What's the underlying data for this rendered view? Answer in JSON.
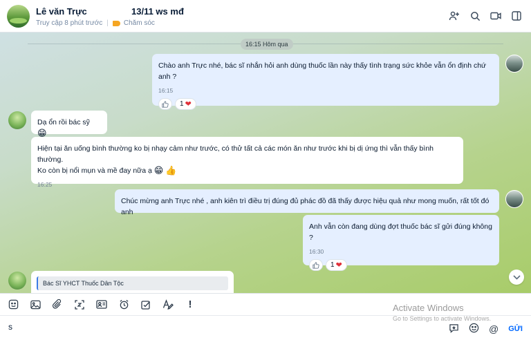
{
  "header": {
    "contact_name": "Lê văn Trực",
    "note": "13/11 ws mđ",
    "last_seen": "Truy cập 8 phút trước",
    "tag_label": "Chăm sóc",
    "tag_color": "#f5a623"
  },
  "header_icons": [
    "add-member-icon",
    "search-icon",
    "video-call-icon",
    "sidebar-toggle-icon"
  ],
  "date_divider": "16:15 Hôm qua",
  "messages": [
    {
      "text": "Chào anh Trực nhé, bác sĩ nhắn hỏi anh dùng thuốc lần này thấy tình trạng sức khỏe vẫn ổn định chứ anh ?",
      "time": "16:15",
      "heart_count": "1"
    },
    {
      "text": "Dạ ổn rồi bác sỹ"
    },
    {
      "line1": "Hiện tại ăn uống bình thường ko bị nhạy cảm như trước, có thử tất cả các món ăn như trước khi bị dị ứng thì vẫn thấy bình thường.",
      "line2": "Ko còn bị nổi mụn và mề đay nữa ạ",
      "time": "16:25"
    },
    {
      "text": "Chúc mừng anh Trực nhé , anh kiên trì điều trị đúng đủ phác đồ đã thấy được hiệu quả như mong muốn, rất tốt đó anh"
    },
    {
      "text": "Anh vẫn còn đang dùng đợt thuốc bác sĩ gửi đúng không ?",
      "time": "16:30",
      "heart_count": "1"
    },
    {
      "quote_title": "Bác Sĩ YHCT Thuốc Dân Tộc"
    }
  ],
  "toolbar_icons": [
    "sticker-icon",
    "image-icon",
    "attachment-icon",
    "screenshot-icon",
    "contact-card-icon",
    "reminder-icon",
    "task-icon",
    "format-text-icon",
    "urgent-icon"
  ],
  "composer": {
    "text": "s",
    "send_label": "GỬI"
  },
  "watermark": {
    "title": "Activate Windows",
    "subtitle": "Go to Settings to activate Windows."
  },
  "colors": {
    "outgoing_bubble": "#e5efff",
    "incoming_bubble": "#ffffff",
    "accent": "#0068ff",
    "heart": "#e0303a"
  }
}
